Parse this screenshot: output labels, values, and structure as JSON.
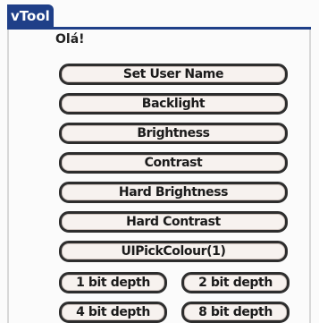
{
  "app": {
    "title": "vTool"
  },
  "label": "Olá!",
  "buttons": {
    "set_user_name": "Set User Name",
    "backlight": "Backlight",
    "brightness": "Brightness",
    "contrast": "Contrast",
    "hard_brightness": "Hard Brightness",
    "hard_contrast": "Hard Contrast",
    "ui_pick_colour": "UIPickColour(1)",
    "bit_depth_1": "1 bit depth",
    "bit_depth_2": "2 bit depth",
    "bit_depth_4": "4 bit depth",
    "bit_depth_8": "8 bit depth"
  },
  "colors": {
    "title_bar": "#1f3f88",
    "button_fill": "#f7f2ef",
    "button_border": "#2d2d2d",
    "background": "#fbfbfb"
  }
}
